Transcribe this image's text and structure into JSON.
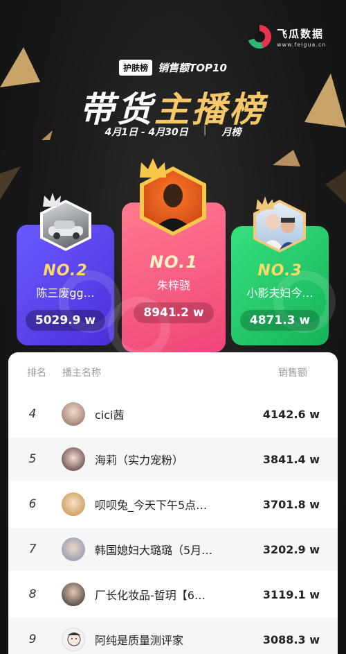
{
  "brand": {
    "name": "飞瓜数据",
    "url": "www.feigua.cn"
  },
  "header": {
    "category_badge": "护肤榜",
    "subtitle": "销售额TOP10",
    "title_white": "带货",
    "title_gold": "主播榜",
    "date_range": "4月1日 - 4月30日",
    "separator": "|",
    "period": "月榜"
  },
  "podium": [
    {
      "rank": "NO.1",
      "name": "朱梓骁",
      "value": "8941.2 w"
    },
    {
      "rank": "NO.2",
      "name": "陈三废gg…",
      "value": "5029.9 w"
    },
    {
      "rank": "NO.3",
      "name": "小影夫妇今…",
      "value": "4871.3 w"
    }
  ],
  "table": {
    "columns": [
      "排名",
      "播主名称",
      "销售额"
    ],
    "rows": [
      {
        "rank": "4",
        "name": "cici茜",
        "value": "4142.6 w"
      },
      {
        "rank": "5",
        "name": "海莉（实力宠粉）",
        "value": "3841.4 w"
      },
      {
        "rank": "6",
        "name": "呗呗兔_今天下午5点…",
        "value": "3701.8 w"
      },
      {
        "rank": "7",
        "name": "韩国媳妇大璐璐（5月…",
        "value": "3202.9 w"
      },
      {
        "rank": "8",
        "name": "厂长化妆品-晢玥【6…",
        "value": "3119.1 w"
      },
      {
        "rank": "9",
        "name": "阿纯是质量测评家",
        "value": "3088.3 w"
      }
    ]
  },
  "colors": {
    "gold": "#f6c86a",
    "card1": "#f0457a",
    "card2": "#4b2fd9",
    "card3": "#16b35a"
  }
}
